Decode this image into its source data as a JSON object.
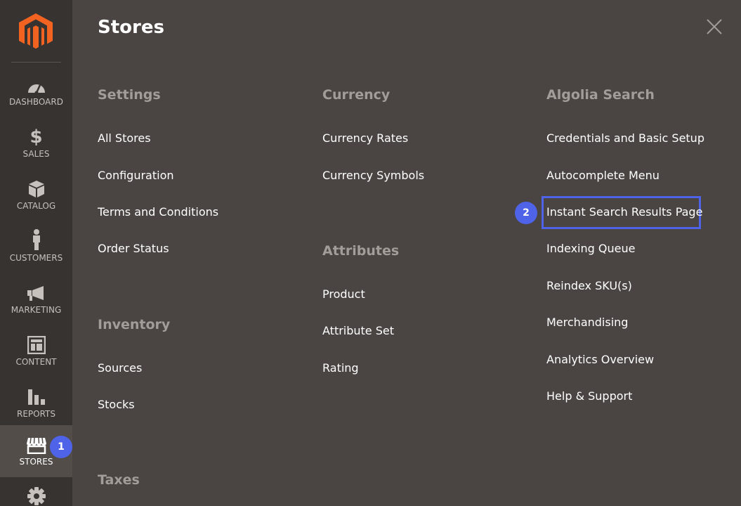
{
  "sidebar": {
    "items": [
      {
        "label": "DASHBOARD",
        "icon": "dashboard-gauge-icon"
      },
      {
        "label": "SALES",
        "icon": "dollar-icon"
      },
      {
        "label": "CATALOG",
        "icon": "box-icon"
      },
      {
        "label": "CUSTOMERS",
        "icon": "person-icon"
      },
      {
        "label": "MARKETING",
        "icon": "megaphone-icon"
      },
      {
        "label": "CONTENT",
        "icon": "layout-icon"
      },
      {
        "label": "REPORTS",
        "icon": "bar-chart-icon"
      },
      {
        "label": "STORES",
        "icon": "storefront-icon"
      },
      {
        "label": "",
        "icon": "gear-icon"
      }
    ],
    "active": "STORES",
    "badge_1": "1"
  },
  "panel": {
    "title": "Stores",
    "close_icon": "close-icon",
    "columns": {
      "settings": {
        "title": "Settings",
        "links": [
          "All Stores",
          "Configuration",
          "Terms and Conditions",
          "Order Status"
        ]
      },
      "inventory": {
        "title": "Inventory",
        "links": [
          "Sources",
          "Stocks"
        ]
      },
      "taxes": {
        "title": "Taxes"
      },
      "currency": {
        "title": "Currency",
        "links": [
          "Currency Rates",
          "Currency Symbols"
        ]
      },
      "attributes": {
        "title": "Attributes",
        "links": [
          "Product",
          "Attribute Set",
          "Rating"
        ]
      },
      "algolia": {
        "title": "Algolia Search",
        "links": [
          "Credentials and Basic Setup",
          "Autocomplete Menu",
          "Instant Search Results Page",
          "Indexing Queue",
          "Reindex SKU(s)",
          "Merchandising",
          "Analytics Overview",
          "Help & Support"
        ]
      }
    },
    "badge_2": "2"
  },
  "colors": {
    "accent": "#4e63e8",
    "logo_orange": "#f26322",
    "sidebar_bg": "#373330",
    "panel_bg": "#4a4542"
  }
}
